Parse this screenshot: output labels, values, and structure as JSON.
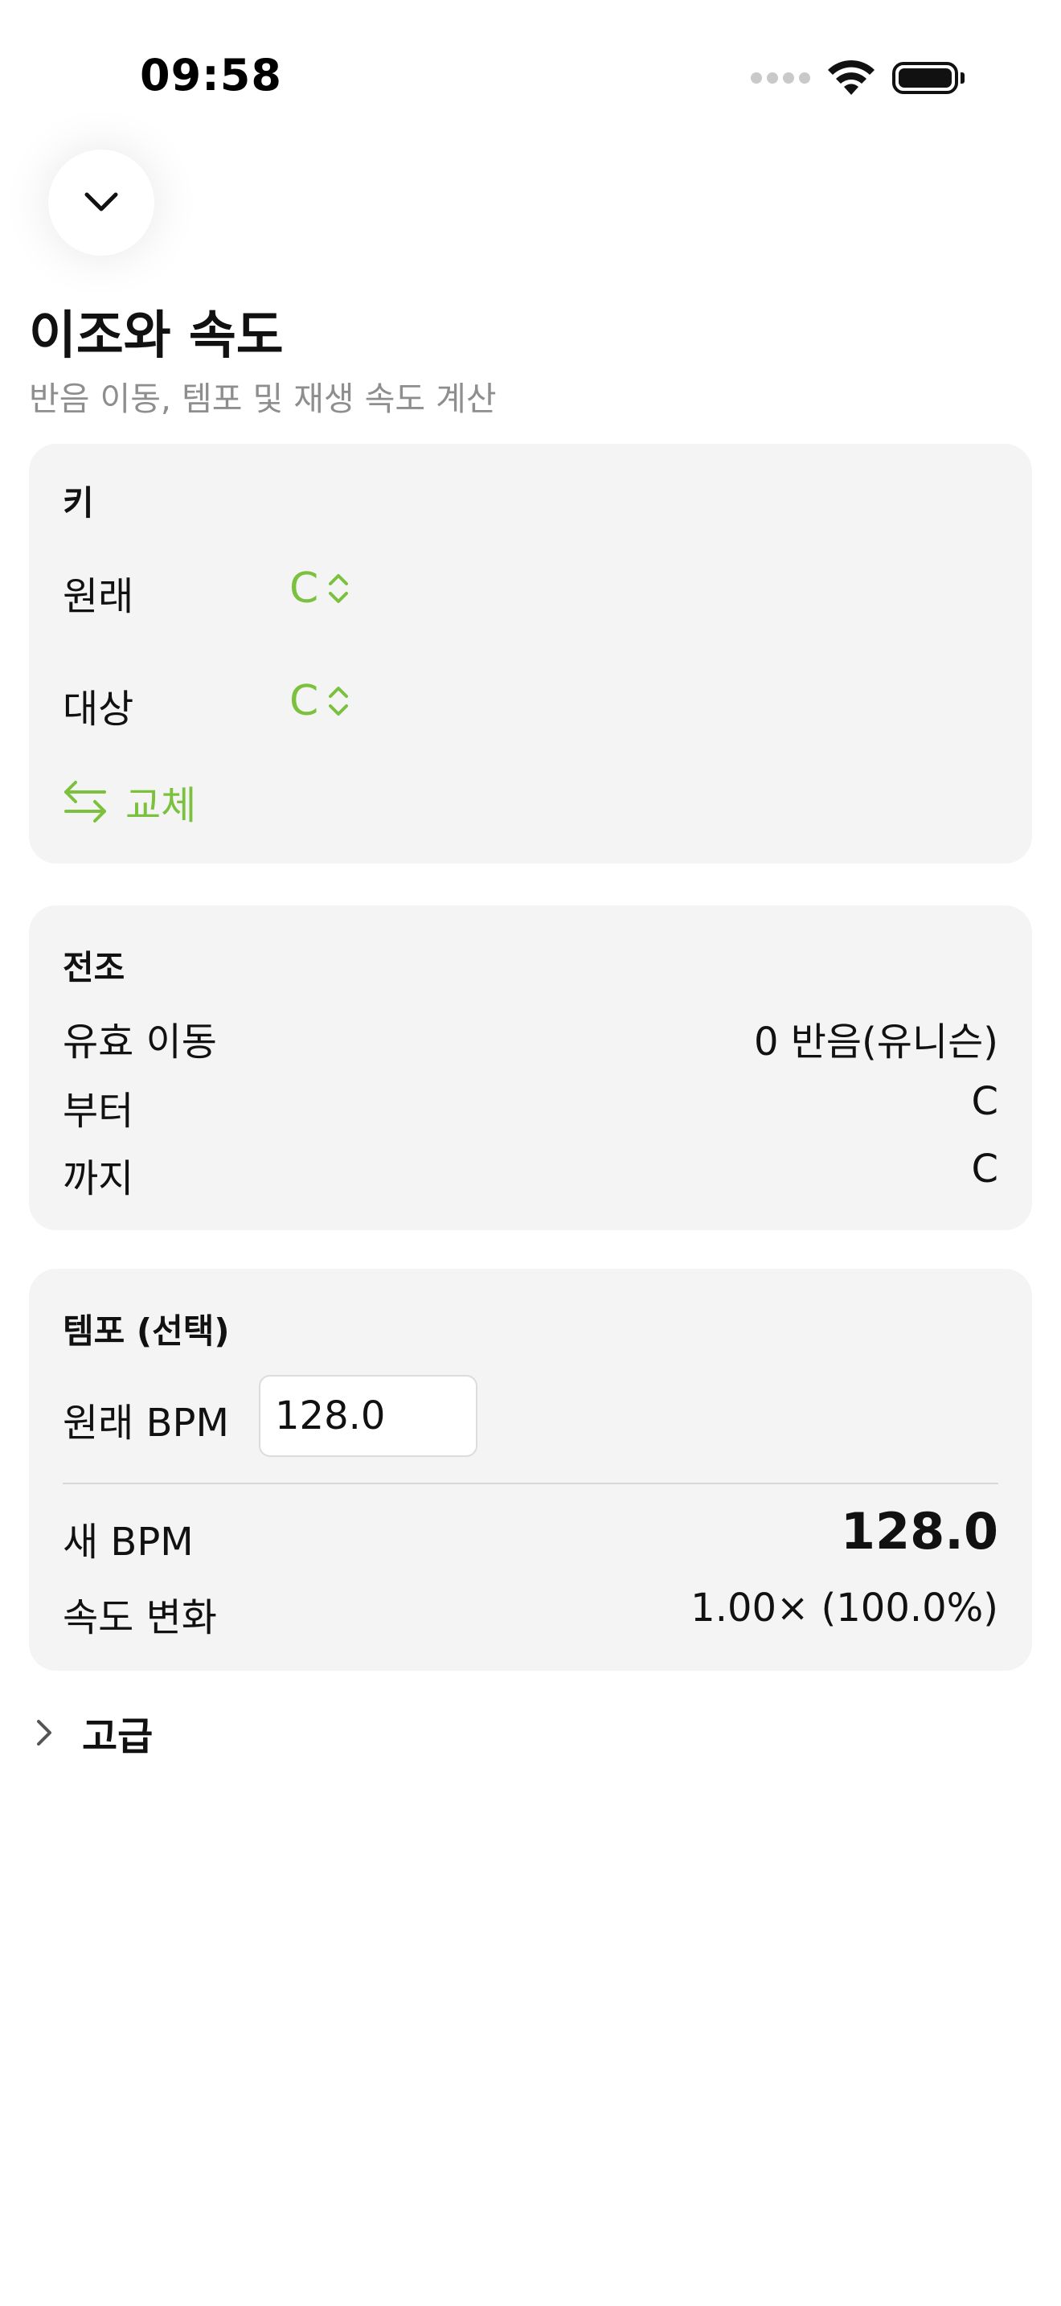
{
  "status_bar": {
    "time": "09:58"
  },
  "header": {
    "title": "이조와 속도",
    "subtitle": "반음 이동, 템포 및 재생 속도 계산"
  },
  "key_card": {
    "title": "키",
    "original_label": "원래",
    "original_value": "C",
    "target_label": "대상",
    "target_value": "C",
    "swap_label": "교체"
  },
  "transpose_card": {
    "title": "전조",
    "rows": [
      {
        "label": "유효 이동",
        "value": "0 반음(유니슨)"
      },
      {
        "label": "부터",
        "value": "C"
      },
      {
        "label": "까지",
        "value": "C"
      }
    ]
  },
  "tempo_card": {
    "title": "템포 (선택)",
    "original_bpm_label": "원래 BPM",
    "original_bpm_value": "128.0",
    "new_bpm_label": "새 BPM",
    "new_bpm_value": "128.0",
    "speed_change_label": "속도 변화",
    "speed_change_value": "1.00× (100.0%)"
  },
  "advanced": {
    "label": "고급"
  },
  "colors": {
    "accent": "#7cc13e",
    "card_background": "#f4f4f4",
    "subtitle_text": "#8e8e8e"
  }
}
